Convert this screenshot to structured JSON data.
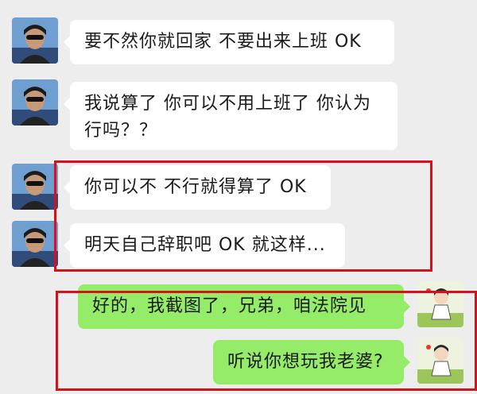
{
  "messages": [
    {
      "sender": "contact",
      "text": "要不然你就回家 不要出来上班 OK"
    },
    {
      "sender": "contact",
      "line1": "我说算了 你可以不用上班了 你认为",
      "line2": "行吗？？"
    },
    {
      "sender": "contact",
      "text": "你可以不 不行就得算了 OK"
    },
    {
      "sender": "contact",
      "text": "明天自己辞职吧 OK 就这样..."
    },
    {
      "sender": "self",
      "text": "好的，我截图了，兄弟，咱法院见"
    },
    {
      "sender": "self",
      "text": "听说你想玩我老婆?"
    }
  ],
  "colors": {
    "incoming_bubble": "#ffffff",
    "outgoing_bubble": "#95ec69",
    "highlight": "#d8101c",
    "background": "#ededed"
  },
  "icons": {
    "contact_avatar": "man-sunglasses-photo-avatar",
    "self_avatar": "cartoon-character-avatar"
  }
}
